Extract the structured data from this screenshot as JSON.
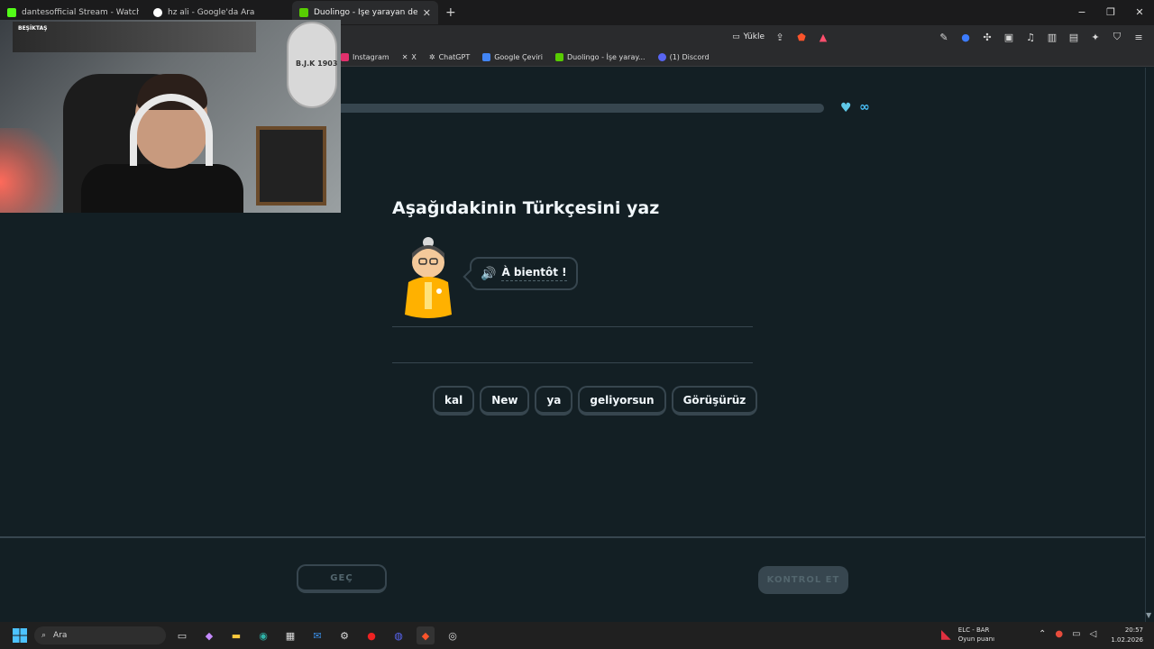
{
  "tabs": [
    {
      "label": "dantesofficial Stream - Watch Live",
      "favicon_color": "#53fc18"
    },
    {
      "label": "hz ali - Google'da Ara",
      "favicon_color": "#ffffff"
    },
    {
      "label": "Duolingo - İşe yarayan dersler",
      "favicon_color": "#58cc02",
      "active": true
    }
  ],
  "new_tab_label": "+",
  "window_controls": {
    "minimize": "−",
    "maximize": "❐",
    "close": "✕"
  },
  "toolbar": {
    "upload_label": "Yükle"
  },
  "bookmarks": [
    {
      "label": "Instagram",
      "color": "#e1306c"
    },
    {
      "label": "X",
      "color": "#ffffff"
    },
    {
      "label": "ChatGPT",
      "color": "#cccccc"
    },
    {
      "label": "Google Çeviri",
      "color": "#4285f4"
    },
    {
      "label": "Duolingo - İşe yaray...",
      "color": "#58cc02"
    },
    {
      "label": "(1) Discord",
      "color": "#5865f2"
    }
  ],
  "lesson": {
    "progress_fraction": 0.0,
    "hearts": "∞",
    "instruction": "Aşağıdakinin Türkçesini yaz",
    "prompt_phrase": "À bientôt !",
    "word_bank": [
      "kal",
      "New",
      "ya",
      "geliyorsun",
      "Görüşürüz"
    ],
    "skip_label": "GEÇ",
    "check_label": "KONTROL ET"
  },
  "webcam": {
    "banner_text": "BEŞİKTAŞ",
    "badge_text": "B.J.K 1903"
  },
  "taskbar": {
    "search_placeholder": "Ara",
    "match_title": "ELC - BAR",
    "match_subtitle": "Oyun puanı",
    "time": "20:57",
    "date": "1.02.2026"
  }
}
